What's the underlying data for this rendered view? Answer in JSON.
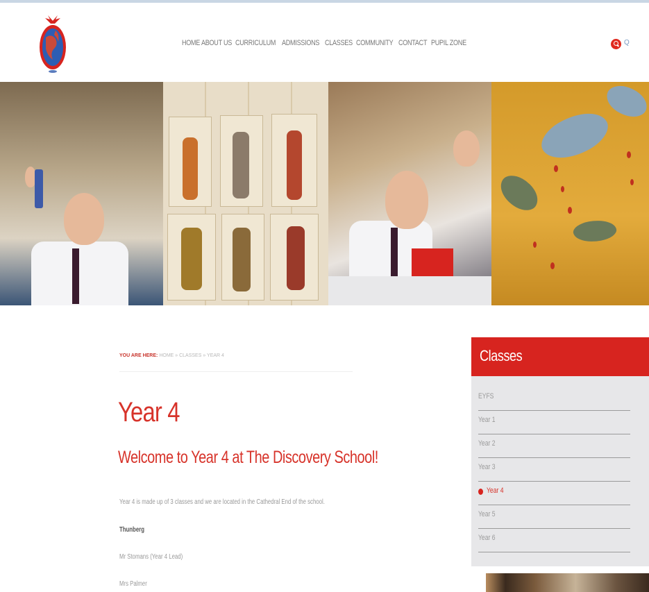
{
  "nav": {
    "items": [
      "HOME",
      "ABOUT US",
      "CURRICULUM",
      "ADMISSIONS",
      "CLASSES",
      "COMMUNITY",
      "CONTACT",
      "PUPIL ZONE"
    ],
    "search_glyph": "Q"
  },
  "breadcrumb": {
    "label": "YOU ARE HERE:",
    "trail": "HOME » CLASSES » YEAR 4"
  },
  "page": {
    "title": "Year 4",
    "subtitle": "Welcome to Year 4 at The Discovery School!",
    "intro": "Year 4 is made up of 3 classes and we are located in the Cathedral End of the school.",
    "class_name": "Thunberg",
    "staff": [
      "Mr Stomans (Year 4 Lead)",
      "Mrs Palmer"
    ]
  },
  "sidebar": {
    "title": "Classes",
    "items": [
      {
        "label": "EYFS",
        "active": false
      },
      {
        "label": "Year 1",
        "active": false
      },
      {
        "label": "Year 2",
        "active": false
      },
      {
        "label": "Year 3",
        "active": false
      },
      {
        "label": "Year 4",
        "active": true
      },
      {
        "label": "Year 5",
        "active": false
      },
      {
        "label": "Year 6",
        "active": false
      }
    ]
  },
  "colors": {
    "accent": "#d7241f",
    "heading": "#d7332a",
    "sidebar_bg": "#e7e7e9"
  },
  "icons": {
    "logo": "school-globe-logo",
    "search": "search-icon",
    "active_marker": "red-drop-icon"
  }
}
